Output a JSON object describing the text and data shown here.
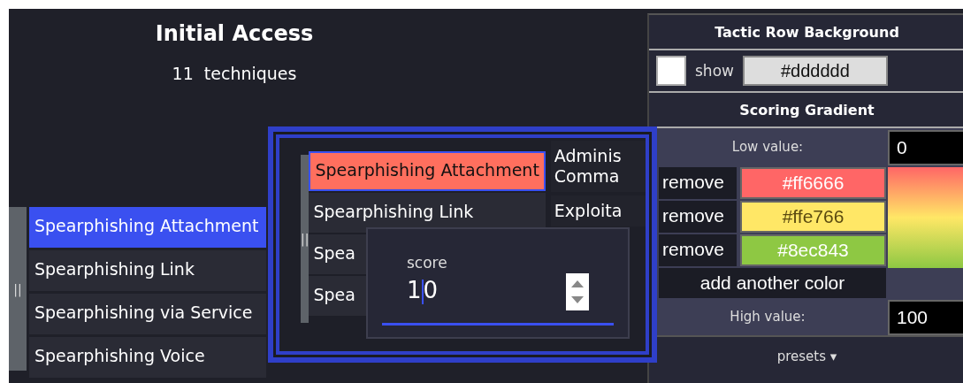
{
  "tactic": {
    "title": "Initial Access",
    "count": "11",
    "count_label": "techniques"
  },
  "handle": "||",
  "techniques": [
    {
      "name": "Spearphishing Attachment",
      "selected": true
    },
    {
      "name": "Spearphishing Link",
      "selected": false
    },
    {
      "name": "Spearphishing via Service",
      "selected": false
    },
    {
      "name": "Spearphishing Voice",
      "selected": false
    }
  ],
  "inset": {
    "handle": "||",
    "techniques": [
      {
        "name": "Spearphishing Attachment",
        "selected": true
      },
      {
        "name": "Spearphishing Link",
        "selected": false
      },
      {
        "name": "Spea",
        "selected": false
      },
      {
        "name": "Spea",
        "selected": false
      }
    ],
    "next_column": [
      {
        "lines": [
          "Adminis",
          "Comma"
        ]
      },
      {
        "lines": [
          "Exploita"
        ]
      }
    ],
    "score": {
      "label": "score",
      "value": "10"
    }
  },
  "panel": {
    "background": {
      "title": "Tactic Row Background",
      "show_label": "show",
      "checked": false,
      "value": "#dddddd"
    },
    "gradient": {
      "title": "Scoring Gradient",
      "low_label": "Low value:",
      "low": "0",
      "colors": [
        {
          "remove": "remove",
          "value": "#ff6666",
          "color": "#ff6666"
        },
        {
          "remove": "remove",
          "value": "#ffe766",
          "color": "#ffe766"
        },
        {
          "remove": "remove",
          "value": "#8ec843",
          "color": "#8ec843"
        }
      ],
      "add": "add another color",
      "high_label": "High value:",
      "high": "100",
      "presets": "presets ▾"
    }
  }
}
